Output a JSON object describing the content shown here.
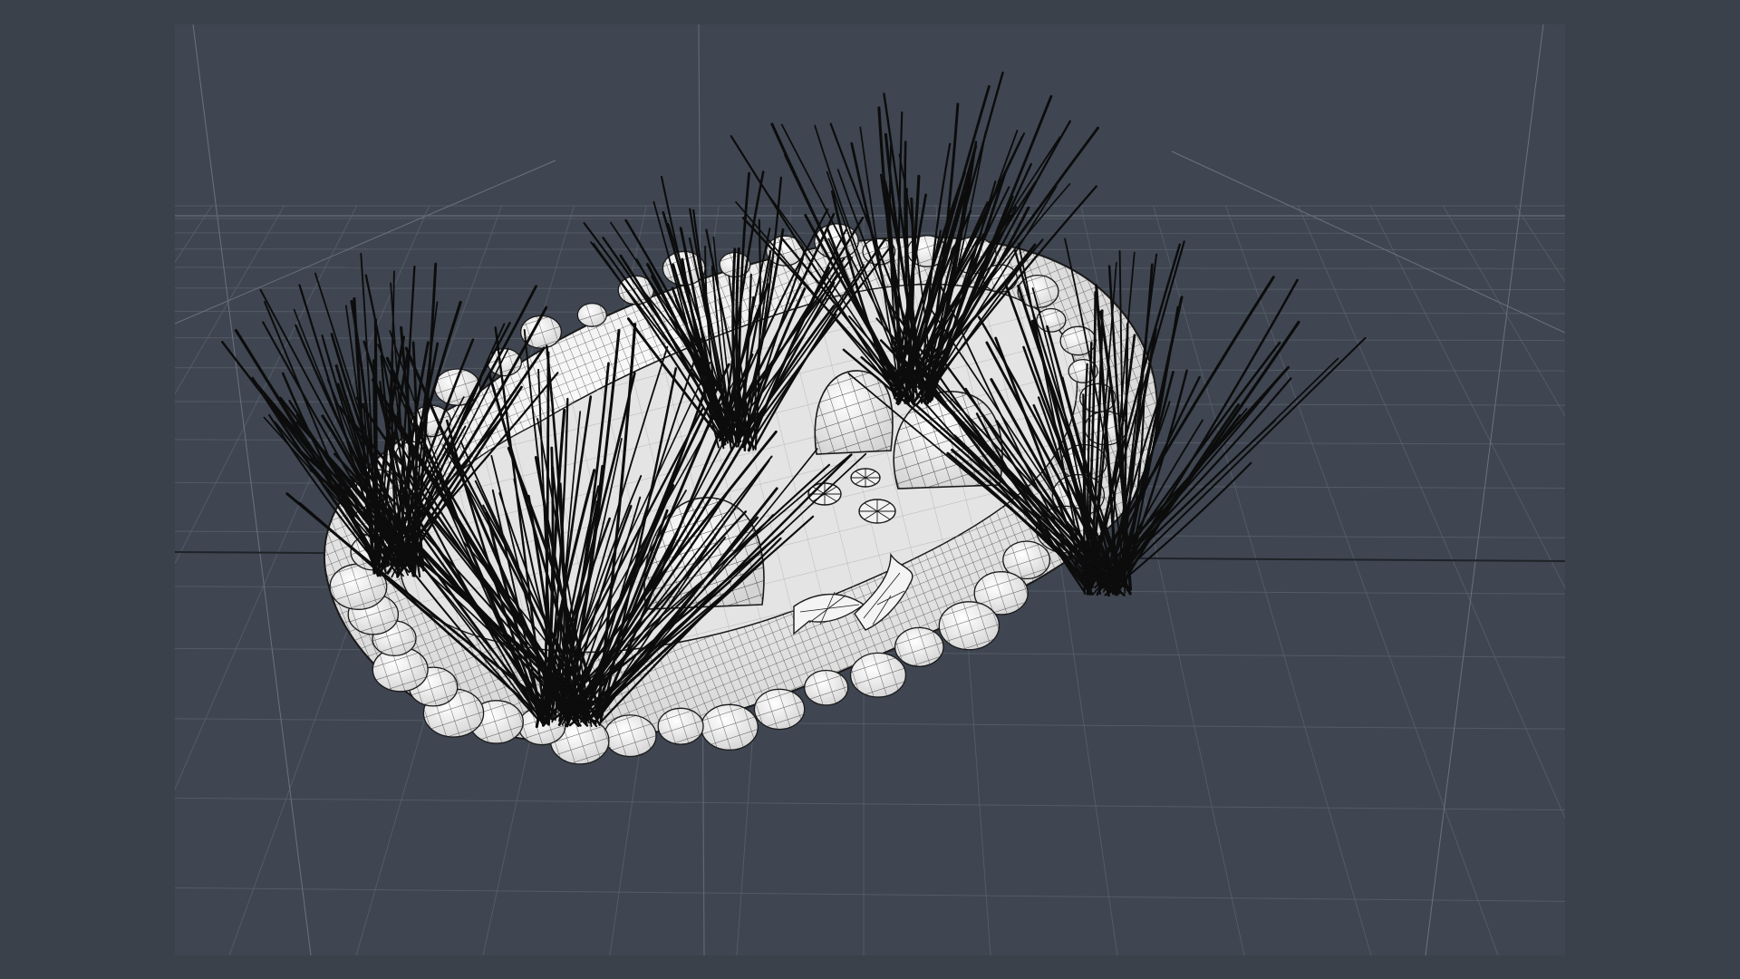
{
  "app": {
    "window_title": ""
  },
  "viewport": {
    "mode": "perspective",
    "shading": "wireframe-on-shaded",
    "background_color": "#3f4651",
    "frame_color": "#3a414b",
    "grid_color": "#5a626c",
    "axis_line_color": "#1e2329",
    "mesh_fill_color": "#ececec",
    "wire_color": "#1a1a1a",
    "grass_color": "#0c0c0c"
  },
  "scene": {
    "objects": [
      {
        "name": "pond-basin",
        "kind": "mesh"
      },
      {
        "name": "pond-rim-stones",
        "kind": "mesh"
      },
      {
        "name": "pond-rock-left",
        "kind": "mesh"
      },
      {
        "name": "pond-rock-back",
        "kind": "mesh"
      },
      {
        "name": "pond-rock-right",
        "kind": "mesh"
      },
      {
        "name": "koi-fish-1",
        "kind": "mesh"
      },
      {
        "name": "koi-fish-2",
        "kind": "mesh"
      },
      {
        "name": "lily-pad-1",
        "kind": "mesh"
      },
      {
        "name": "lily-pad-2",
        "kind": "mesh"
      },
      {
        "name": "lily-pad-3",
        "kind": "mesh"
      },
      {
        "name": "grass-clump-front-left",
        "kind": "mesh"
      },
      {
        "name": "grass-clump-left",
        "kind": "mesh"
      },
      {
        "name": "grass-clump-back-center",
        "kind": "mesh"
      },
      {
        "name": "grass-clump-back-right",
        "kind": "mesh"
      },
      {
        "name": "grass-clump-right",
        "kind": "mesh"
      }
    ]
  }
}
